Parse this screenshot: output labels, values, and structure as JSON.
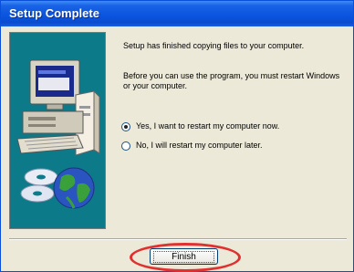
{
  "window": {
    "title": "Setup Complete"
  },
  "content": {
    "line1": "Setup has finished copying files to your computer.",
    "line2": "Before you can use the program, you must restart Windows or your computer."
  },
  "options": [
    {
      "label": "Yes, I want to restart my computer now.",
      "selected": true
    },
    {
      "label": "No, I will restart my computer later.",
      "selected": false
    }
  ],
  "footer": {
    "finish_label": "Finish"
  },
  "colors": {
    "title_bar": "#0b55e0",
    "side_panel": "#0c7a88",
    "highlight": "#e03030"
  },
  "icons": {
    "side_art": "computer-and-discs-icon"
  }
}
